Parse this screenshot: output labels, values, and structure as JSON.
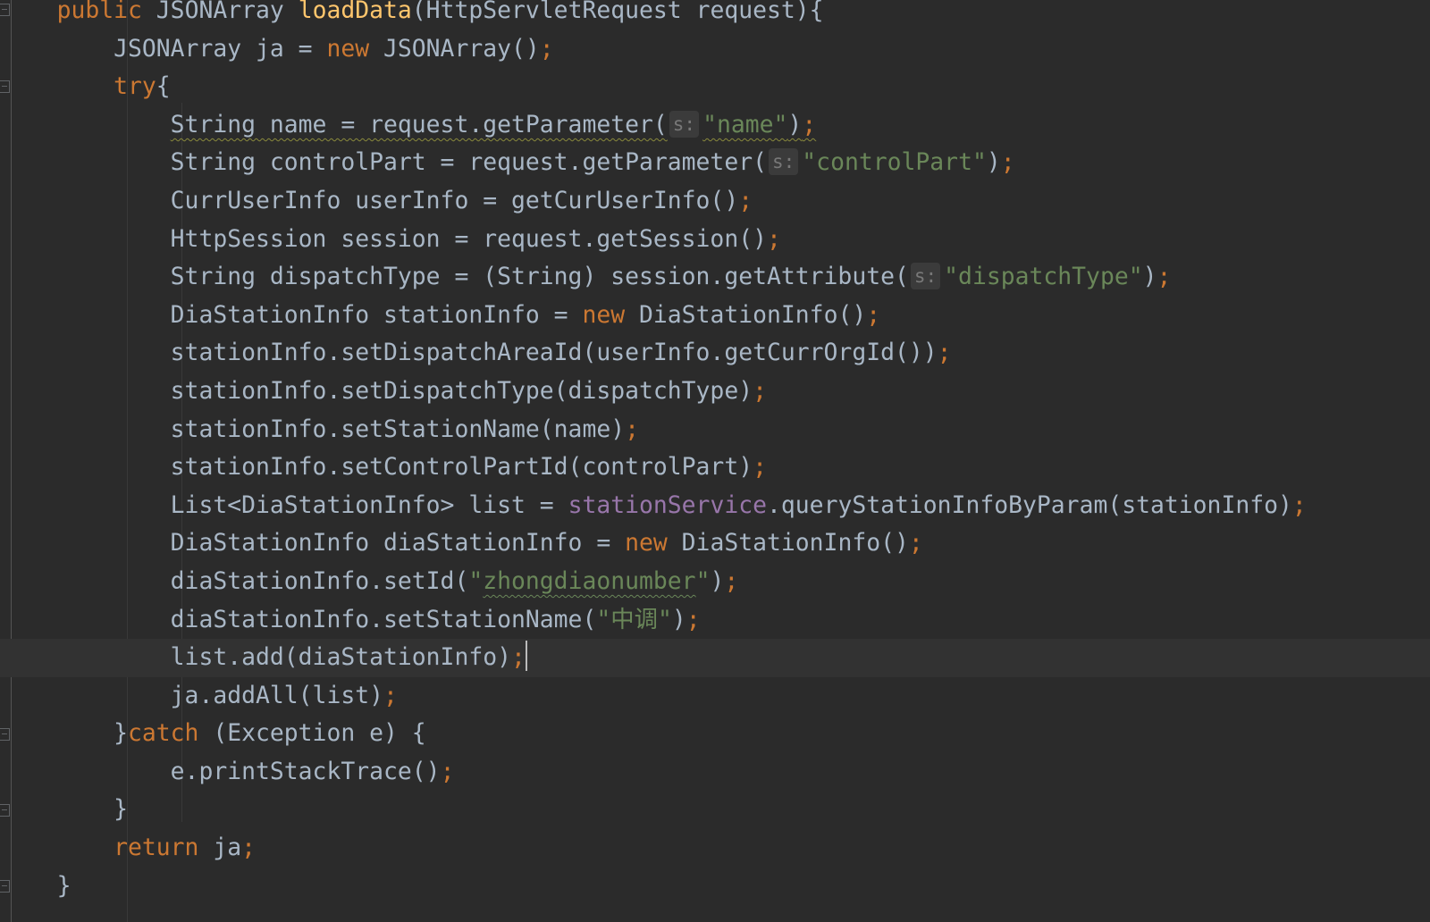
{
  "editor": {
    "theme_colors": {
      "background": "#2b2b2b",
      "text": "#a9b7c6",
      "keyword": "#cc7832",
      "method_declaration": "#ffc66d",
      "string": "#6a8759",
      "field": "#9876aa",
      "current_line": "#323232"
    },
    "lines": [
      {
        "indent": "    ",
        "t": [
          "public",
          " JSONArray ",
          "loadData",
          "(HttpServletRequest request){"
        ]
      },
      {
        "indent": "        ",
        "t": [
          "JSONArray ja = ",
          "new",
          " JSONArray()",
          ";"
        ]
      },
      {
        "indent": "        ",
        "t": [
          "try",
          "{"
        ]
      },
      {
        "indent": "            ",
        "t": [
          "String name = request.getParameter(",
          "s:",
          "\"name\"",
          ")",
          ";"
        ]
      },
      {
        "indent": "            ",
        "t": [
          "String controlPart = request.getParameter(",
          "s:",
          "\"controlPart\"",
          ")",
          ";"
        ]
      },
      {
        "indent": "            ",
        "t": [
          "CurrUserInfo userInfo = getCurUserInfo()",
          ";"
        ]
      },
      {
        "indent": "            ",
        "t": [
          "HttpSession session = request.getSession()",
          ";"
        ]
      },
      {
        "indent": "            ",
        "t": [
          "String dispatchType = (String) session.getAttribute(",
          "s:",
          "\"dispatchType\"",
          ")",
          ";"
        ]
      },
      {
        "indent": "            ",
        "t": [
          "DiaStationInfo stationInfo = ",
          "new",
          " DiaStationInfo()",
          ";"
        ]
      },
      {
        "indent": "            ",
        "t": [
          "stationInfo.setDispatchAreaId(userInfo.getCurrOrgId())",
          ";"
        ]
      },
      {
        "indent": "            ",
        "t": [
          "stationInfo.setDispatchType(dispatchType)",
          ";"
        ]
      },
      {
        "indent": "            ",
        "t": [
          "stationInfo.setStationName(name)",
          ";"
        ]
      },
      {
        "indent": "            ",
        "t": [
          "stationInfo.setControlPartId(controlPart)",
          ";"
        ]
      },
      {
        "indent": "            ",
        "t": [
          "List<DiaStationInfo> list = ",
          "stationService",
          ".queryStationInfoByParam(stationInfo)",
          ";"
        ]
      },
      {
        "indent": "            ",
        "t": [
          "DiaStationInfo diaStationInfo = ",
          "new",
          " DiaStationInfo()",
          ";"
        ]
      },
      {
        "indent": "            ",
        "t": [
          "diaStationInfo.setId(",
          "\"",
          "zhongdiaonumber",
          "\"",
          ")",
          ";"
        ]
      },
      {
        "indent": "            ",
        "t": [
          "diaStationInfo.setStationName(",
          "\"中调\"",
          ")",
          ";"
        ]
      },
      {
        "indent": "            ",
        "t": [
          "list.add(diaStationInfo)",
          ";"
        ]
      },
      {
        "indent": "            ",
        "t": [
          "ja.addAll(list)",
          ";"
        ]
      },
      {
        "indent": "        ",
        "t": [
          "}",
          "catch",
          " (Exception e) {"
        ]
      },
      {
        "indent": "            ",
        "t": [
          "e.printStackTrace()",
          ";"
        ]
      },
      {
        "indent": "        ",
        "t": [
          "}"
        ]
      },
      {
        "indent": "        ",
        "t": [
          "return",
          " ja",
          ";"
        ]
      },
      {
        "indent": "    ",
        "t": [
          "}"
        ]
      }
    ]
  }
}
